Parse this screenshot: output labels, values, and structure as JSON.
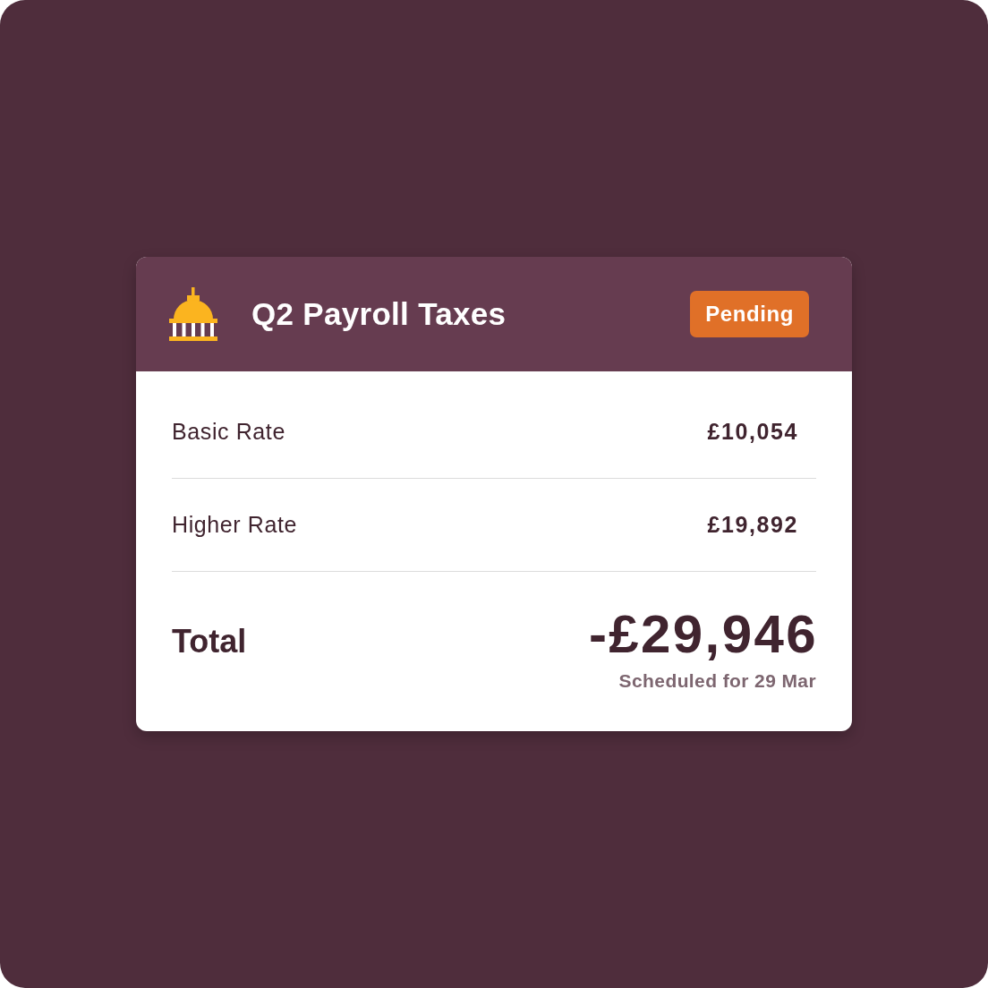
{
  "card": {
    "title": "Q2 Payroll Taxes",
    "status": "Pending"
  },
  "line_items": [
    {
      "label": "Basic Rate",
      "amount": "£10,054"
    },
    {
      "label": "Higher Rate",
      "amount": "£19,892"
    }
  ],
  "total": {
    "label": "Total",
    "amount": "-£29,946",
    "note": "Scheduled for 29 Mar"
  }
}
